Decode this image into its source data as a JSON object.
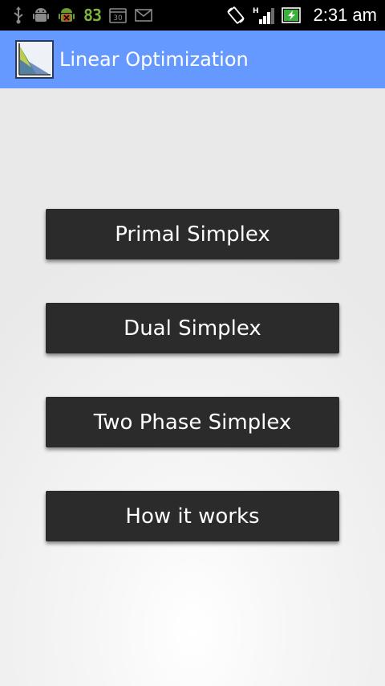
{
  "status_bar": {
    "notification_icons": [
      "usb-icon",
      "android-debug-icon",
      "android-bug-icon",
      "calendar-icon",
      "email-icon"
    ],
    "notification_count": "83",
    "calendar_day": "30",
    "time": "2:31 am",
    "network_type": "H",
    "status_icons": [
      "screen-rotation-icon",
      "signal-icon",
      "battery-charging-icon"
    ]
  },
  "action_bar": {
    "title": "Linear Optimization",
    "icon": "app-chart-icon",
    "background_color": "#6699ff"
  },
  "menu": {
    "buttons": [
      {
        "label": "Primal Simplex"
      },
      {
        "label": "Dual Simplex"
      },
      {
        "label": "Two Phase Simplex"
      },
      {
        "label": "How it works"
      }
    ],
    "button_color": "#2b2b2b"
  }
}
